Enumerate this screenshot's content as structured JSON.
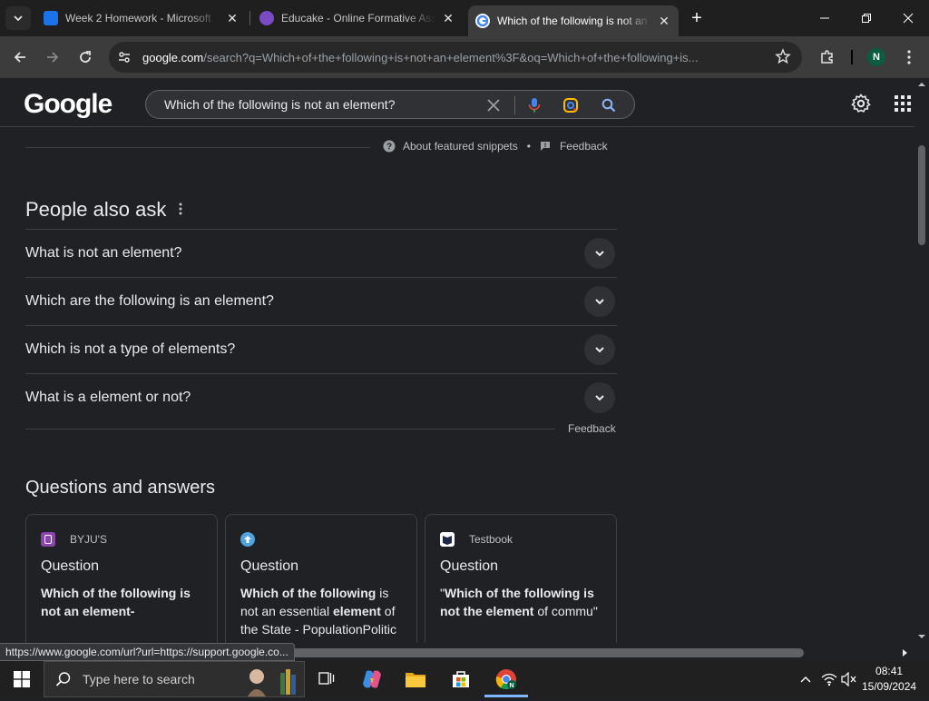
{
  "browser": {
    "tabs": [
      {
        "title": "Week 2 Homework - Microsoft",
        "favicon": "classroom-icon",
        "color": "#1a73e8"
      },
      {
        "title": "Educake - Online Formative Ass",
        "favicon": "educake-icon",
        "color": "#7b4bc4"
      },
      {
        "title": "Which of the following is not an",
        "favicon": "google-icon",
        "color": "#ffffff",
        "active": true
      }
    ],
    "url_host": "google.com",
    "url_path": "/search?q=Which+of+the+following+is+not+an+element%3F&oq=Which+of+the+following+is...",
    "profile_initial": "N"
  },
  "google": {
    "logo": "Google",
    "query": "Which of the following is not an element?"
  },
  "snippet": {
    "about_label": "About featured snippets",
    "separator": "•",
    "feedback_label": "Feedback"
  },
  "paa": {
    "title": "People also ask",
    "questions": [
      "What is not an element?",
      "Which are the following is an element?",
      "Which is not a type of elements?",
      "What is a element or not?"
    ],
    "feedback_label": "Feedback"
  },
  "qa": {
    "title": "Questions and answers",
    "cards": [
      {
        "source": "BYJU'S",
        "label": "Question"
      },
      {
        "source": "",
        "label": "Question"
      },
      {
        "source": "Testbook",
        "label": "Question"
      }
    ],
    "card_texts": {
      "c1_b1": "Which of the following is not an element-",
      "c2_b1": "Which of the following",
      "c2_t1": " is not an essential ",
      "c2_b2": "element",
      "c2_t2": " of the State - ",
      "c2_t3": "PopulationPolitic",
      "c3_t1": "\"",
      "c3_b1": "Which of the following is not the element",
      "c3_t2": " of commu\""
    }
  },
  "status_bar": {
    "hover_url": "https://www.google.com/url?url=https://support.google.co..."
  },
  "taskbar": {
    "search_placeholder": "Type here to search",
    "time": "08:41",
    "date": "15/09/2024"
  }
}
